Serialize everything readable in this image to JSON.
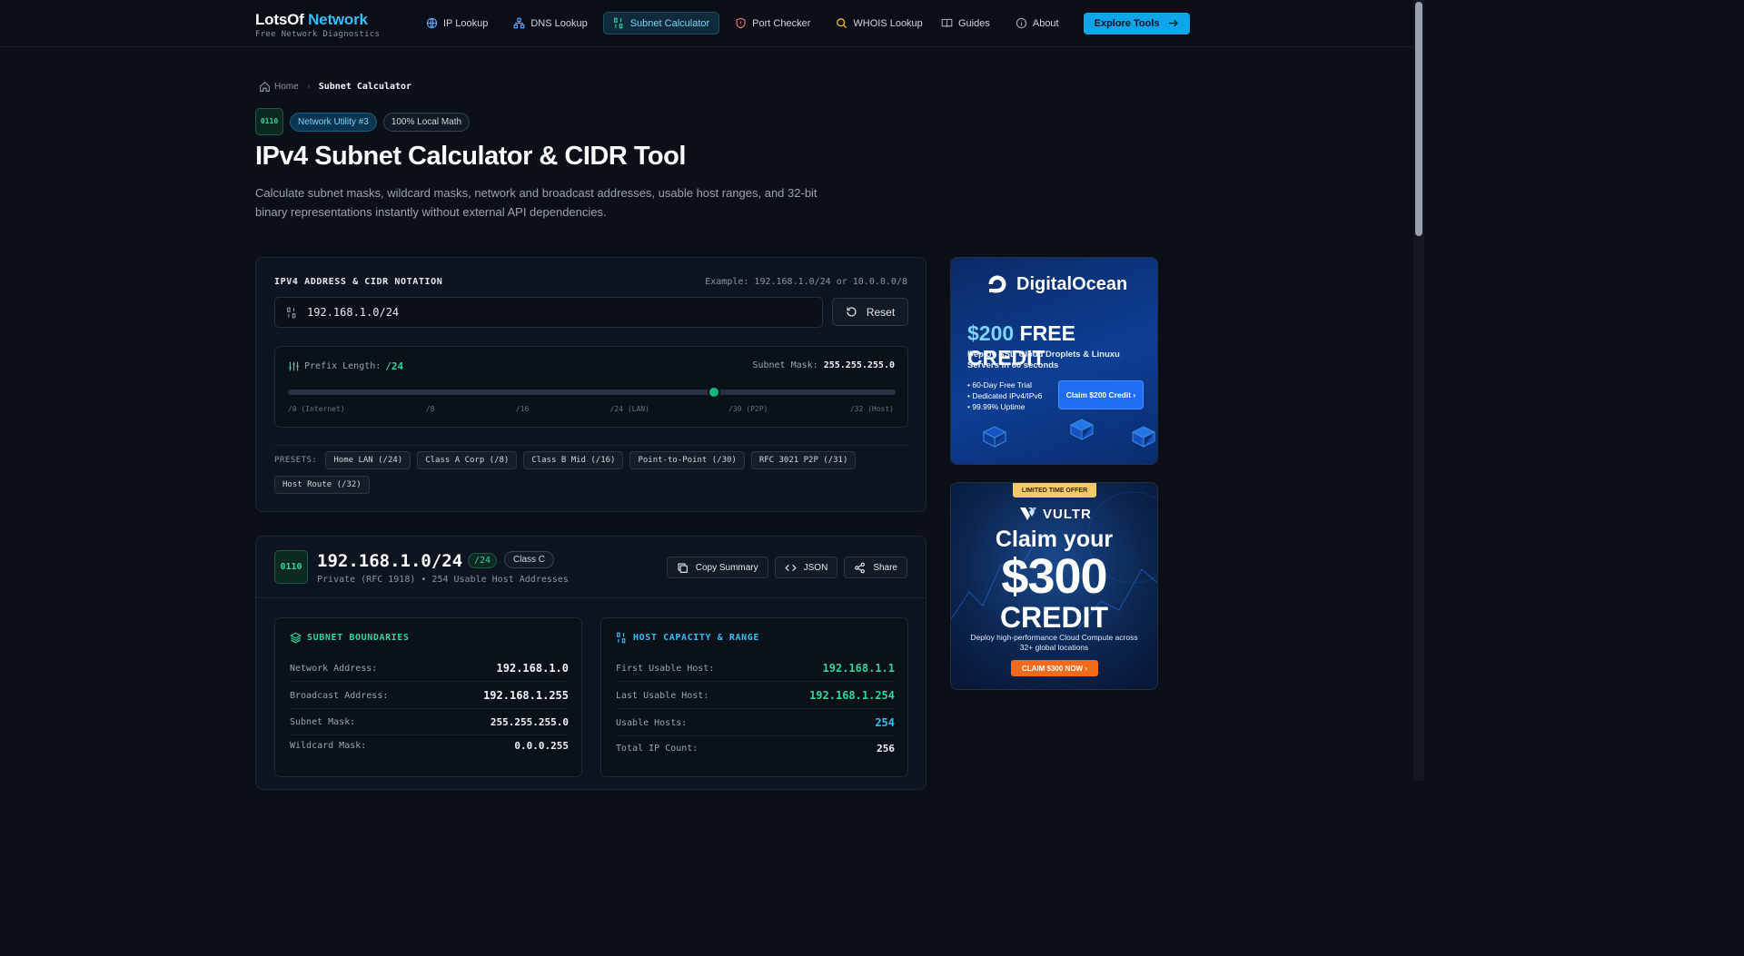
{
  "brand": {
    "name_part1": "LotsOf",
    "name_part2": "Network",
    "tagline": "Free Network Diagnostics"
  },
  "nav": {
    "items": [
      {
        "label": "IP Lookup",
        "icon": "globe-icon"
      },
      {
        "label": "DNS Lookup",
        "icon": "network-icon"
      },
      {
        "label": "Subnet Calculator",
        "icon": "binary-icon",
        "active": true
      },
      {
        "label": "Port Checker",
        "icon": "shield-icon"
      },
      {
        "label": "WHOIS Lookup",
        "icon": "search-icon"
      }
    ],
    "guides": "Guides",
    "about": "About",
    "cta": "Explore Tools"
  },
  "breadcrumb": {
    "home": "Home",
    "current": "Subnet Calculator"
  },
  "badges": {
    "icon_text_top": "01",
    "icon_text_bottom": "10",
    "utility": "Network Utility #3",
    "local": "100% Local Math"
  },
  "page": {
    "title": "IPv4 Subnet Calculator & CIDR Tool",
    "description": "Calculate subnet masks, wildcard masks, network and broadcast addresses, usable host ranges, and 32-bit binary representations instantly without external API dependencies."
  },
  "calculator": {
    "field_label": "IPV4 ADDRESS & CIDR NOTATION",
    "example": "Example: 192.168.1.0/24 or 10.0.0.0/8",
    "input_value": "192.168.1.0/24",
    "reset_label": "Reset",
    "prefix_label": "Prefix Length:",
    "prefix_value": "/24",
    "prefix_number": 24,
    "prefix_max": 32,
    "mask_label": "Subnet Mask:",
    "mask_value": "255.255.255.0",
    "ticks": [
      "/0 (Internet)",
      "/8",
      "/16",
      "/24 (LAN)",
      "/30 (P2P)",
      "/32 (Host)"
    ],
    "presets_label": "PRESETS:",
    "presets": [
      "Home LAN (/24)",
      "Class A Corp (/8)",
      "Class B Mid (/16)",
      "Point-to-Point (/30)",
      "RFC 3021 P2P (/31)",
      "Host Route (/32)"
    ]
  },
  "result": {
    "cidr": "192.168.1.0/24",
    "prefix_tag": "/24",
    "class_tag": "Class C",
    "meta": "Private (RFC 1918) • 254 Usable Host Addresses",
    "actions": {
      "copy": "Copy Summary",
      "json": "JSON",
      "share": "Share"
    },
    "boundaries": {
      "title": "SUBNET BOUNDARIES",
      "rows": [
        {
          "k": "Network Address:",
          "v": "192.168.1.0"
        },
        {
          "k": "Broadcast Address:",
          "v": "192.168.1.255"
        },
        {
          "k": "Subnet Mask:",
          "v": "255.255.255.0"
        },
        {
          "k": "Wildcard Mask:",
          "v": "0.0.0.255"
        }
      ]
    },
    "capacity": {
      "title": "HOST CAPACITY & RANGE",
      "rows": [
        {
          "k": "First Usable Host:",
          "v": "192.168.1.1"
        },
        {
          "k": "Last Usable Host:",
          "v": "192.168.1.254"
        },
        {
          "k": "Usable Hosts:",
          "v": "254"
        },
        {
          "k": "Total IP Count:",
          "v": "256"
        }
      ]
    }
  },
  "ads": {
    "digitalocean": {
      "brand": "DigitalOcean",
      "credit_amount": "$200",
      "credit_text": "FREE CREDIT",
      "description": "Deploy SSD Cloud Droplets & Linuxu Servers in 60 seconds",
      "features": [
        "• 60-Day Free Trial",
        "• Dedicated IPv4/IPv6",
        "• 99.99% Uptime"
      ],
      "button": "Claim $200 Credit ›"
    },
    "vultr": {
      "ribbon": "LIMITED TIME OFFER",
      "brand": "VULTR",
      "claim": "Claim your",
      "amount": "$300",
      "credit": "CREDIT",
      "description": "Deploy high-performance Cloud Compute across 32+ global locations",
      "button": "CLAIM $300 NOW ›"
    }
  }
}
